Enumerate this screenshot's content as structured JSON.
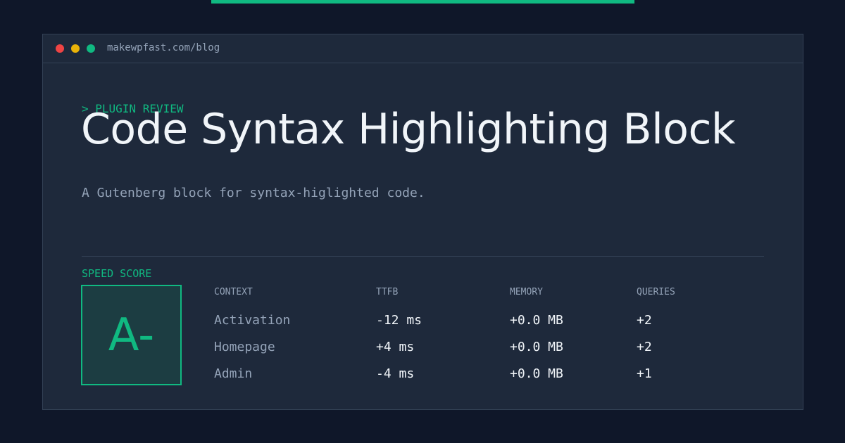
{
  "window": {
    "url": "makewpfast.com/blog"
  },
  "article": {
    "kicker": "> PLUGIN REVIEW",
    "title": "Code Syntax Highlighting Block",
    "subtitle": "A Gutenberg block for syntax-higlighted code."
  },
  "speed": {
    "label": "SPEED SCORE",
    "grade": "A-"
  },
  "table": {
    "headers": [
      "CONTEXT",
      "TTFB",
      "MEMORY",
      "QUERIES"
    ],
    "rows": [
      [
        "Activation",
        "-12 ms",
        "+0.0 MB",
        "+2"
      ],
      [
        "Homepage",
        "+4 ms",
        "+0.0 MB",
        "+2"
      ],
      [
        "Admin",
        "-4 ms",
        "+0.0 MB",
        "+1"
      ]
    ]
  },
  "colors": {
    "background": "#0f1729",
    "window": "#1e293b",
    "accent": "#10b981",
    "muted_text": "#94a3b8",
    "bright_text": "#f1f5f9",
    "dot_red": "#ef4444",
    "dot_yellow": "#eab308",
    "dot_green": "#10b981"
  },
  "icons": {
    "window_controls": [
      "close-dot-icon",
      "minimize-dot-icon",
      "maximize-dot-icon"
    ]
  }
}
